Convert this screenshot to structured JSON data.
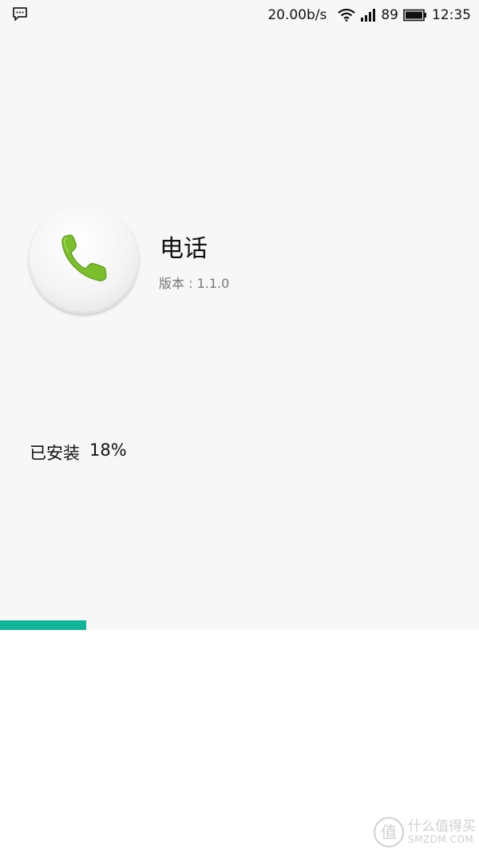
{
  "status_bar": {
    "network_speed": "20.00b/s",
    "signal_strength": "89",
    "time": "12:35",
    "icons": [
      "message-icon",
      "wifi-icon",
      "signal-icon",
      "battery-icon"
    ]
  },
  "app": {
    "name": "电话",
    "version": "版本 : 1.1.0",
    "icon": "phone-icon"
  },
  "install": {
    "label": "已安装",
    "percent_text": "18%",
    "progress": 0.18
  },
  "colors": {
    "accent": "#13b39a",
    "phone_green": "#7cbf2c",
    "background": "#f7f7f7"
  },
  "watermark": {
    "logo_glyph": "值",
    "cn": "什么值得买",
    "en": "SMZDM.COM"
  }
}
